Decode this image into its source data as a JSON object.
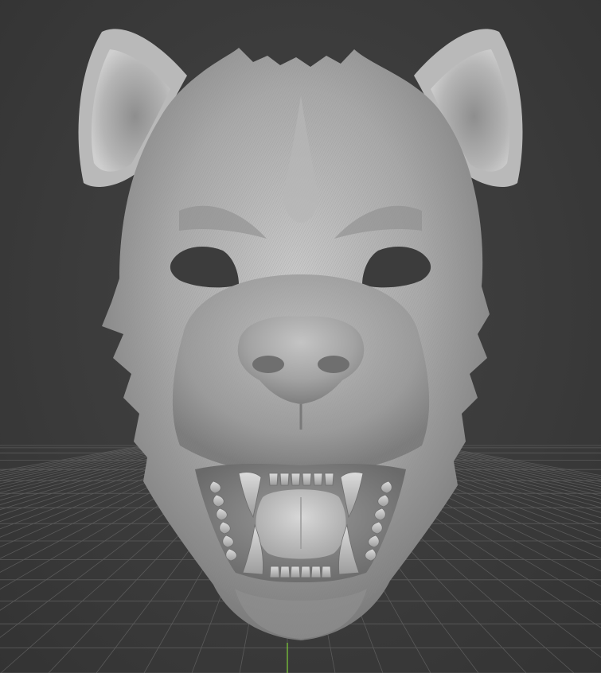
{
  "viewport": {
    "background_color": "#3b3b3b",
    "grid_line_color": "#5a5a5a",
    "axis_line_color": "#7fcf3a",
    "model_base_color": "#a9a9a9",
    "model_shadow_color": "#6e6e6e",
    "model_highlight_color": "#d4d4d4"
  },
  "model": {
    "subject": "hyena-head-mask-sculpt"
  }
}
